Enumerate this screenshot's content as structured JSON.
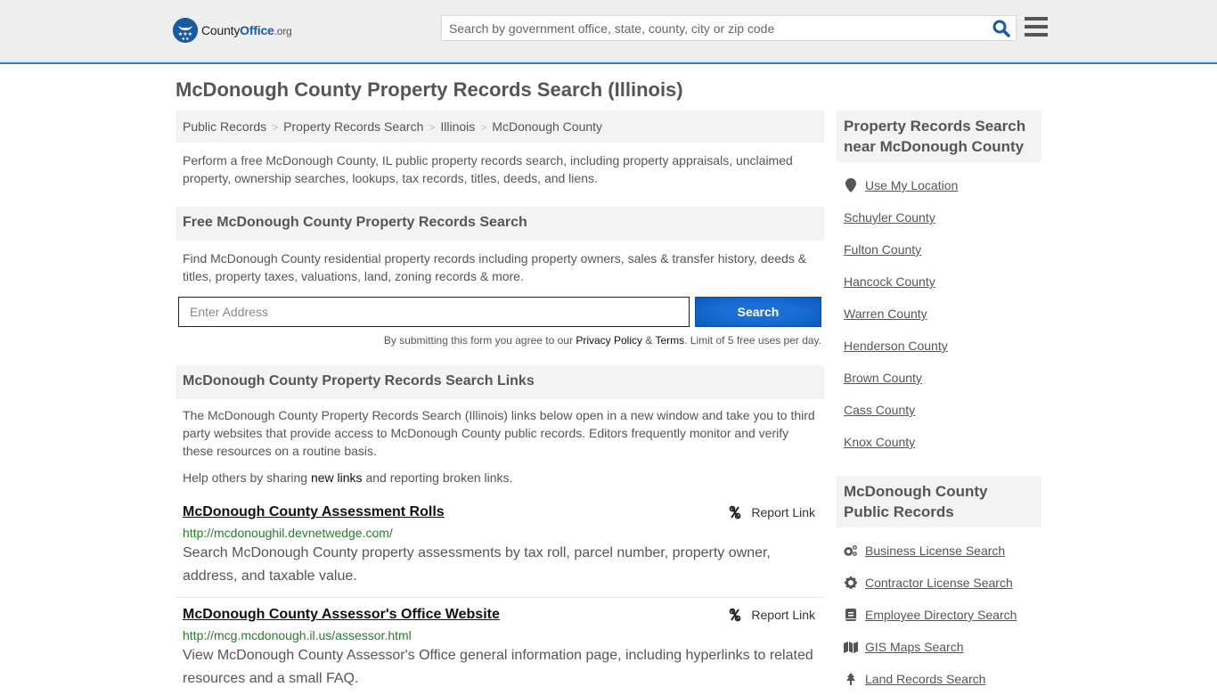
{
  "header": {
    "logo": {
      "county": "County",
      "office": "Office",
      "org": ".org"
    },
    "search_placeholder": "Search by government office, state, county, city or zip code"
  },
  "page_title": "McDonough County Property Records Search (Illinois)",
  "breadcrumb": [
    "Public Records",
    "Property Records Search",
    "Illinois",
    "McDonough County"
  ],
  "intro": "Perform a free McDonough County, IL public property records search, including property appraisals, unclaimed property, ownership searches, lookups, tax records, titles, deeds, and liens.",
  "free_search": {
    "heading": "Free McDonough County Property Records Search",
    "description": "Find McDonough County residential property records including property owners, sales & transfer history, deeds & titles, property taxes, valuations, land, zoning records & more.",
    "address_placeholder": "Enter Address",
    "button_label": "Search",
    "disclaimer_prefix": "By submitting this form you agree to our ",
    "privacy_label": "Privacy Policy",
    "amp": " & ",
    "terms_label": "Terms",
    "disclaimer_suffix": ". Limit of 5 free uses per day."
  },
  "links_section": {
    "heading": "McDonough County Property Records Search Links",
    "description": "The McDonough County Property Records Search (Illinois) links below open in a new window and take you to third party websites that provide access to McDonough County public records. Editors frequently monitor and verify these resources on a routine basis.",
    "help_prefix": "Help others by sharing ",
    "help_link": "new links",
    "help_suffix": " and reporting broken links.",
    "report_label": "Report Link",
    "items": [
      {
        "title": "McDonough County Assessment Rolls",
        "url": "http://mcdonoughil.devnetwedge.com/",
        "description": "Search McDonough County property assessments by tax roll, parcel number, property owner, address, and taxable value."
      },
      {
        "title": "McDonough County Assessor's Office Website",
        "url": "http://mcg.mcdonough.il.us/assessor.html",
        "description": "View McDonough County Assessor's Office general information page, including hyperlinks to related resources and a small FAQ."
      }
    ]
  },
  "sidebar": {
    "nearby_heading": "Property Records Search near McDonough County",
    "use_location": "Use My Location",
    "nearby": [
      "Schuyler County",
      "Fulton County",
      "Hancock County",
      "Warren County",
      "Henderson County",
      "Brown County",
      "Cass County",
      "Knox County"
    ],
    "public_heading": "McDonough County Public Records",
    "public_records": [
      {
        "label": "Business License Search",
        "icon": "cogs-icon"
      },
      {
        "label": "Contractor License Search",
        "icon": "gear-icon"
      },
      {
        "label": "Employee Directory Search",
        "icon": "book-icon"
      },
      {
        "label": "GIS Maps Search",
        "icon": "map-icon"
      },
      {
        "label": "Land Records Search",
        "icon": "tree-icon"
      }
    ]
  }
}
